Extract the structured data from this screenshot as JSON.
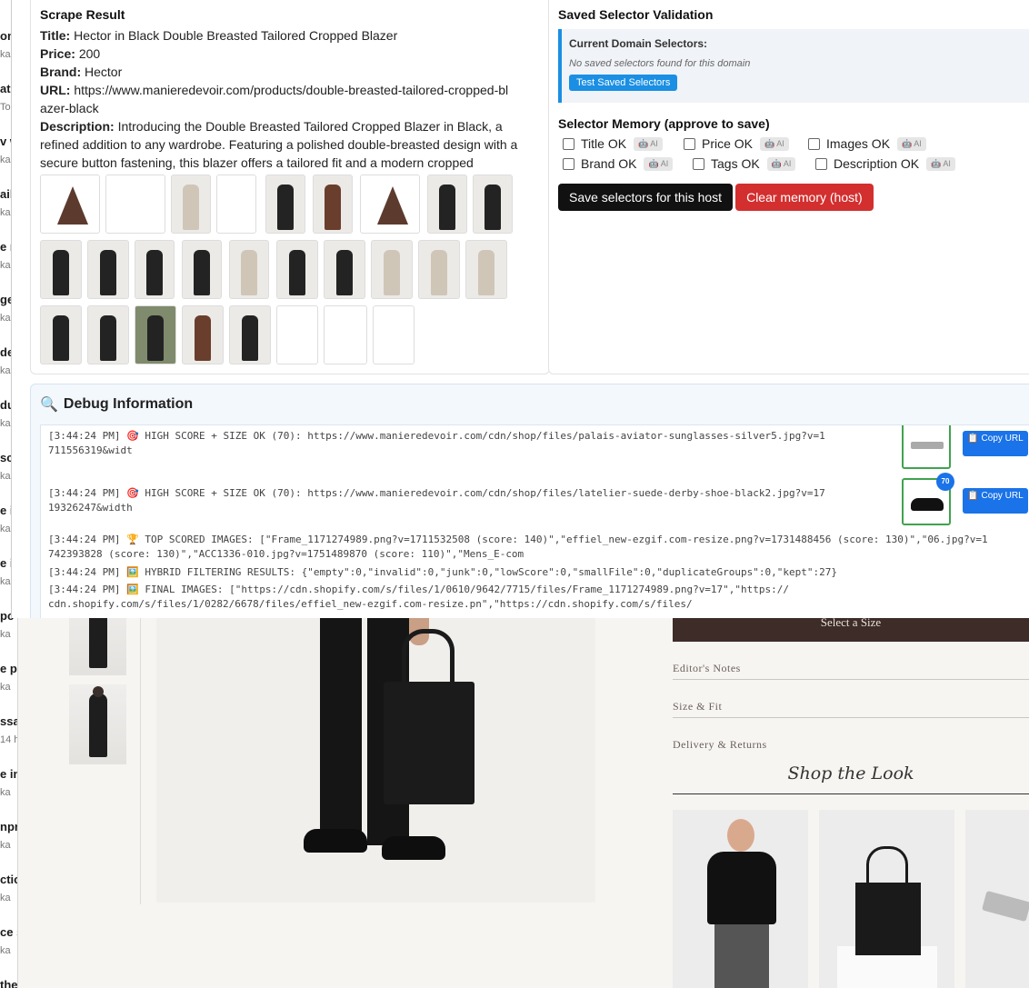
{
  "scrape": {
    "heading": "Scrape Result",
    "title_label": "Title:",
    "title": "Hector in Black Double Breasted Tailored Cropped Blazer",
    "price_label": "Price:",
    "price": "200",
    "brand_label": "Brand:",
    "brand": "Hector",
    "url_label": "URL:",
    "url": "https://www.manieredevoir.com/products/double-breasted-tailored-cropped-blazer-black",
    "desc_label": "Description:",
    "description": "Introducing the Double Breasted Tailored Cropped Blazer in Black, a refined addition to any wardrobe. Featuring a polished double-breasted design with a secure button fastening, this blazer offers a tailored fit and a modern cropped silhouette"
  },
  "validation": {
    "heading": "Saved Selector Validation",
    "current_label": "Current Domain Selectors:",
    "none_text": "No saved selectors found for this domain",
    "test_button": "Test Saved Selectors"
  },
  "memory": {
    "heading": "Selector Memory (approve to save)",
    "ai_label": "🤖 AI",
    "checks": [
      "Title OK",
      "Price OK",
      "Images OK",
      "Brand OK",
      "Tags OK",
      "Description OK"
    ],
    "save_button": "Save selectors for this host",
    "clear_button": "Clear memory (host)"
  },
  "debug": {
    "heading": "Debug Information",
    "icon": "🔍",
    "copy_label": "📋 Copy URL",
    "logs": [
      "[3:44:24 PM] 🎯 HIGH SCORE + SIZE OK (70): https://www.manieredevoir.com/cdn/shop/files/palais-aviator-sunglasses-silver5.jpg?v=1711556319&widt",
      "[3:44:24 PM] 🎯 HIGH SCORE + SIZE OK (70): https://www.manieredevoir.com/cdn/shop/files/latelier-suede-derby-shoe-black2.jpg?v=1719326247&width",
      "[3:44:24 PM] 🏆 TOP SCORED IMAGES: [\"Frame_1171274989.png?v=1711532508 (score: 140)\",\"effiel_new-ezgif.com-resize.png?v=1731488456 (score: 130)\",\"06.jpg?v=1742393828 (score: 130)\",\"ACC1336-010.jpg?v=1751489870 (score: 110)\",\"Mens_E-com",
      "[3:44:24 PM] 🖼️ HYBRID FILTERING RESULTS: {\"empty\":0,\"invalid\":0,\"junk\":0,\"lowScore\":0,\"smallFile\":0,\"duplicateGroups\":0,\"kept\":27}",
      "[3:44:24 PM] 🖼️ FINAL IMAGES: [\"https://cdn.shopify.com/s/files/1/0610/9642/7715/files/Frame_1171274989.png?v=17\",\"https://cdn.shopify.com/s/files/1/0282/6678/files/effiel_new-ezgif.com-resize.pn\",\"https://cdn.shopify.com/s/files/"
    ],
    "scores": [
      "70"
    ]
  },
  "site": {
    "select_size": "Select a Size",
    "accordions": [
      "Editor's Notes",
      "Size & Fit",
      "Delivery & Returns"
    ],
    "shop_the_look": "Shop the Look"
  },
  "left_strip": [
    {
      "t": "om",
      "s": "ka"
    },
    {
      "t": "ati",
      "s": "To"
    },
    {
      "t": "v w",
      "s": "ka"
    },
    {
      "t": "ail",
      "s": "ka"
    },
    {
      "t": "e m",
      "s": "ka"
    },
    {
      "t": "ge",
      "s": "ka"
    },
    {
      "t": "de",
      "s": "ka"
    },
    {
      "t": "du",
      "s": "ka"
    },
    {
      "t": "sc",
      "s": "ka"
    },
    {
      "t": "e in",
      "s": "ka"
    },
    {
      "t": "e in",
      "s": "ka"
    },
    {
      "t": "pc",
      "s": "ka"
    },
    {
      "t": "e pr",
      "s": "ka"
    },
    {
      "t": "ssa",
      "s": "14 h"
    },
    {
      "t": "e im",
      "s": "ka"
    },
    {
      "t": "npr",
      "s": "ka"
    },
    {
      "t": "ctio",
      "s": "ka"
    },
    {
      "t": "ce s",
      "s": "ka"
    },
    {
      "t": "the",
      "s": ""
    }
  ]
}
